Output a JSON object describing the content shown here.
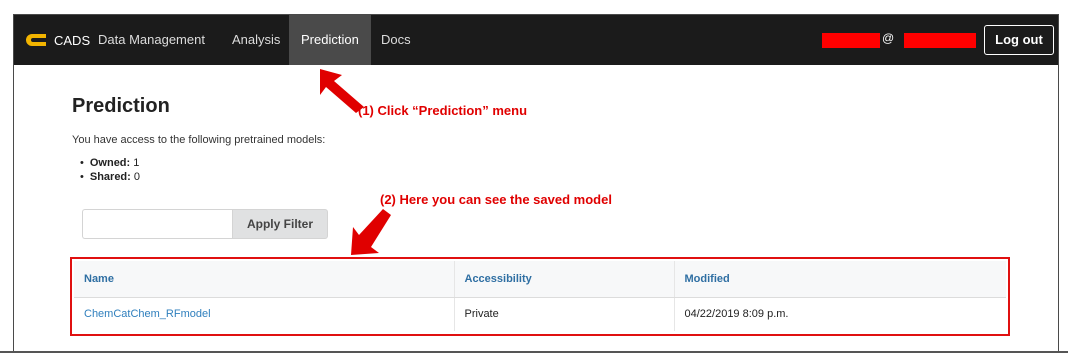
{
  "navbar": {
    "brand": "CADS",
    "items": [
      {
        "label": "Data Management"
      },
      {
        "label": "Analysis"
      },
      {
        "label": "Prediction",
        "active": true
      },
      {
        "label": "Docs"
      }
    ],
    "user_separator": "@",
    "logout_label": "Log out"
  },
  "main": {
    "title": "Prediction",
    "intro": "You have access to the following pretrained models:",
    "stats": [
      {
        "label": "Owned:",
        "value": "1"
      },
      {
        "label": "Shared:",
        "value": "0"
      }
    ],
    "filter": {
      "value": "",
      "placeholder": "",
      "button_label": "Apply Filter"
    },
    "table": {
      "headers": [
        "Name",
        "Accessibility",
        "Modified"
      ],
      "rows": [
        {
          "name": "ChemCatChem_RFmodel",
          "accessibility": "Private",
          "modified": "04/22/2019 8:09 p.m."
        }
      ]
    }
  },
  "annotations": {
    "step1": "(1) Click “Prediction” menu",
    "step2": "(2) Here you can see the saved model"
  },
  "colors": {
    "navbar": "#1b1b1b",
    "active_nav": "#4a4a4a",
    "annotation_red": "#e00000",
    "link_blue": "#2f7fbd",
    "logo_yellow": "#f2b400"
  },
  "icons": {
    "logo": "cads-logo-icon",
    "arrow": "red-arrow-icon"
  }
}
